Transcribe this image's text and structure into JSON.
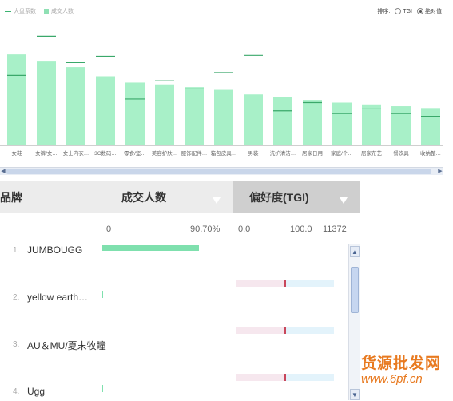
{
  "legend": {
    "line_label": "大盘系数",
    "bar_label": "成交人数"
  },
  "sort": {
    "label": "排序:",
    "option_tgi": "TGI",
    "option_absolute": "绝对值",
    "selected": "绝对值"
  },
  "colors": {
    "bar": "#a8f0c8",
    "line": "#3cb371",
    "marker": "#3aa86a",
    "deal_bar": "#7fe0ae",
    "tgi_left": "#f6e7ee",
    "tgi_right": "#e3f3fb",
    "tgi_mark": "#c8465a",
    "watermark": "#e87a20"
  },
  "chart_data": {
    "type": "bar",
    "categories": [
      "女鞋",
      "女裤/女…",
      "女士内衣…",
      "3C数码…",
      "零食/坚…",
      "美容护肤…",
      "服饰配件…",
      "箱包皮具…",
      "男装",
      "洗护清洁…",
      "居家日用",
      "家庭/个…",
      "居家布艺",
      "餐饮具",
      "收纳整…"
    ],
    "series": [
      {
        "values": [
          100,
          93,
          86,
          76,
          69,
          67,
          64,
          61,
          56,
          53,
          50,
          47,
          45,
          43,
          41
        ]
      },
      {
        "values": [
          77,
          120,
          91,
          98,
          51,
          71,
          62,
          80,
          99,
          38,
          47,
          35,
          40,
          35,
          32
        ]
      }
    ],
    "ylim": [
      0,
      130
    ]
  },
  "table": {
    "col_brand": "品牌",
    "col_deal": "成交人数",
    "col_tgi": "偏好度(TGI)",
    "deal_scale": {
      "min": "0",
      "max": "90.70%"
    },
    "tgi_scale": {
      "min": "0.0",
      "mid": "100.0",
      "max": "11372"
    },
    "rows": [
      {
        "rank": "1.",
        "name": "JUMBOUGG",
        "deal_pct": 90.7,
        "tgi": null
      },
      {
        "rank": "2.",
        "name": "yellow earth…",
        "deal_pct": 0.3,
        "tgi": 100
      },
      {
        "rank": "3.",
        "name": "AU＆MU/夏末牧瞳",
        "deal_pct": 0,
        "tgi": 100
      },
      {
        "rank": "4.",
        "name": "Ugg",
        "deal_pct": 0.3,
        "tgi": 100
      }
    ]
  },
  "watermark": {
    "line1": "货源批发网",
    "line2": "www.6pf.cn"
  }
}
